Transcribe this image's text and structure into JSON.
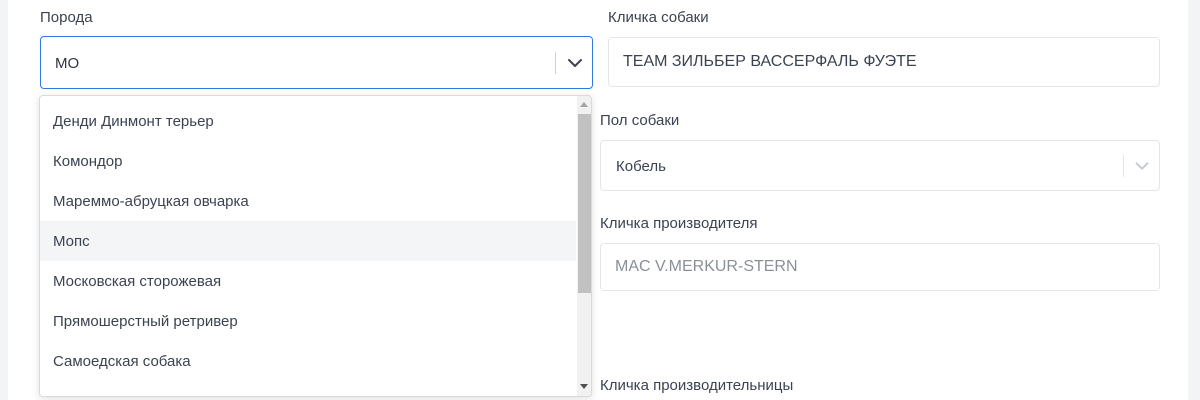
{
  "form": {
    "breed_label": "Порода",
    "breed_value": "МО",
    "dog_name_label": "Кличка собаки",
    "dog_name_value": "TEAM ЗИЛЬБЕР ВАССЕРФАЛЬ ФУЭТЕ",
    "sex_label": "Пол собаки",
    "sex_value": "Кобель",
    "sire_label": "Кличка производителя",
    "sire_value": "MAC V.MERKUR-STERN",
    "dam_label": "Кличка производительницы"
  },
  "dropdown": {
    "options": [
      "Денди Динмонт терьер",
      "Комондор",
      "Мареммо-абруцкая овчарка",
      "Мопс",
      "Московская сторожевая",
      "Прямошерстный ретривер",
      "Самоедская собака"
    ],
    "hovered_index": 3
  },
  "colors": {
    "accent_border": "#2b7bdc",
    "field_border": "#e3e6ea",
    "hover_bg": "#f4f5f7"
  }
}
